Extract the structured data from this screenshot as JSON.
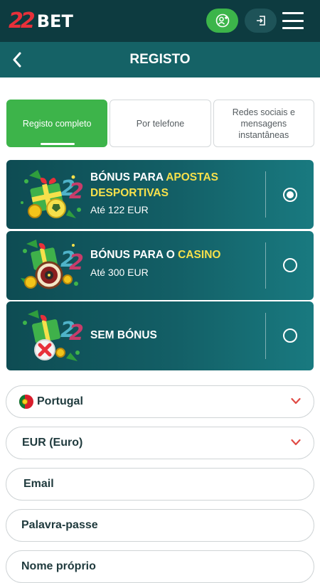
{
  "header": {
    "logo_number": "22",
    "logo_text": "BET",
    "icons": {
      "user": "user-add-icon",
      "login": "login-icon",
      "menu": "hamburger-menu-icon"
    }
  },
  "subheader": {
    "title": "REGISTO",
    "back_icon": "chevron-left-icon"
  },
  "tabs": [
    {
      "label": "Registo completo",
      "active": true
    },
    {
      "label": "Por telefone",
      "active": false
    },
    {
      "label": "Redes sociais e mensagens instantâneas",
      "active": false
    }
  ],
  "bonuses": [
    {
      "title_plain": "BÓNUS PARA ",
      "title_highlight": "APOSTAS DESPORTIVAS",
      "subtitle": "Até 122 EUR",
      "selected": true,
      "art_icon": "sports-bonus-gift-icon"
    },
    {
      "title_plain": "BÓNUS PARA O ",
      "title_highlight": "CASINO",
      "subtitle": "Até 300 EUR",
      "selected": false,
      "art_icon": "casino-bonus-roulette-icon"
    },
    {
      "title_plain": "SEM BÓNUS",
      "title_highlight": "",
      "subtitle": "",
      "selected": false,
      "art_icon": "no-bonus-gift-icon"
    }
  ],
  "form": {
    "country": "Portugal",
    "currency": "EUR (Euro)",
    "email_placeholder": "Email",
    "password_placeholder": "Palavra-passe",
    "first_name_placeholder": "Nome próprio"
  },
  "colors": {
    "header_bg": "#0d3b40",
    "subheader_bg": "#156266",
    "accent_green": "#3db44a",
    "highlight_yellow": "#f6e04b",
    "brand_red": "#e8303a"
  }
}
